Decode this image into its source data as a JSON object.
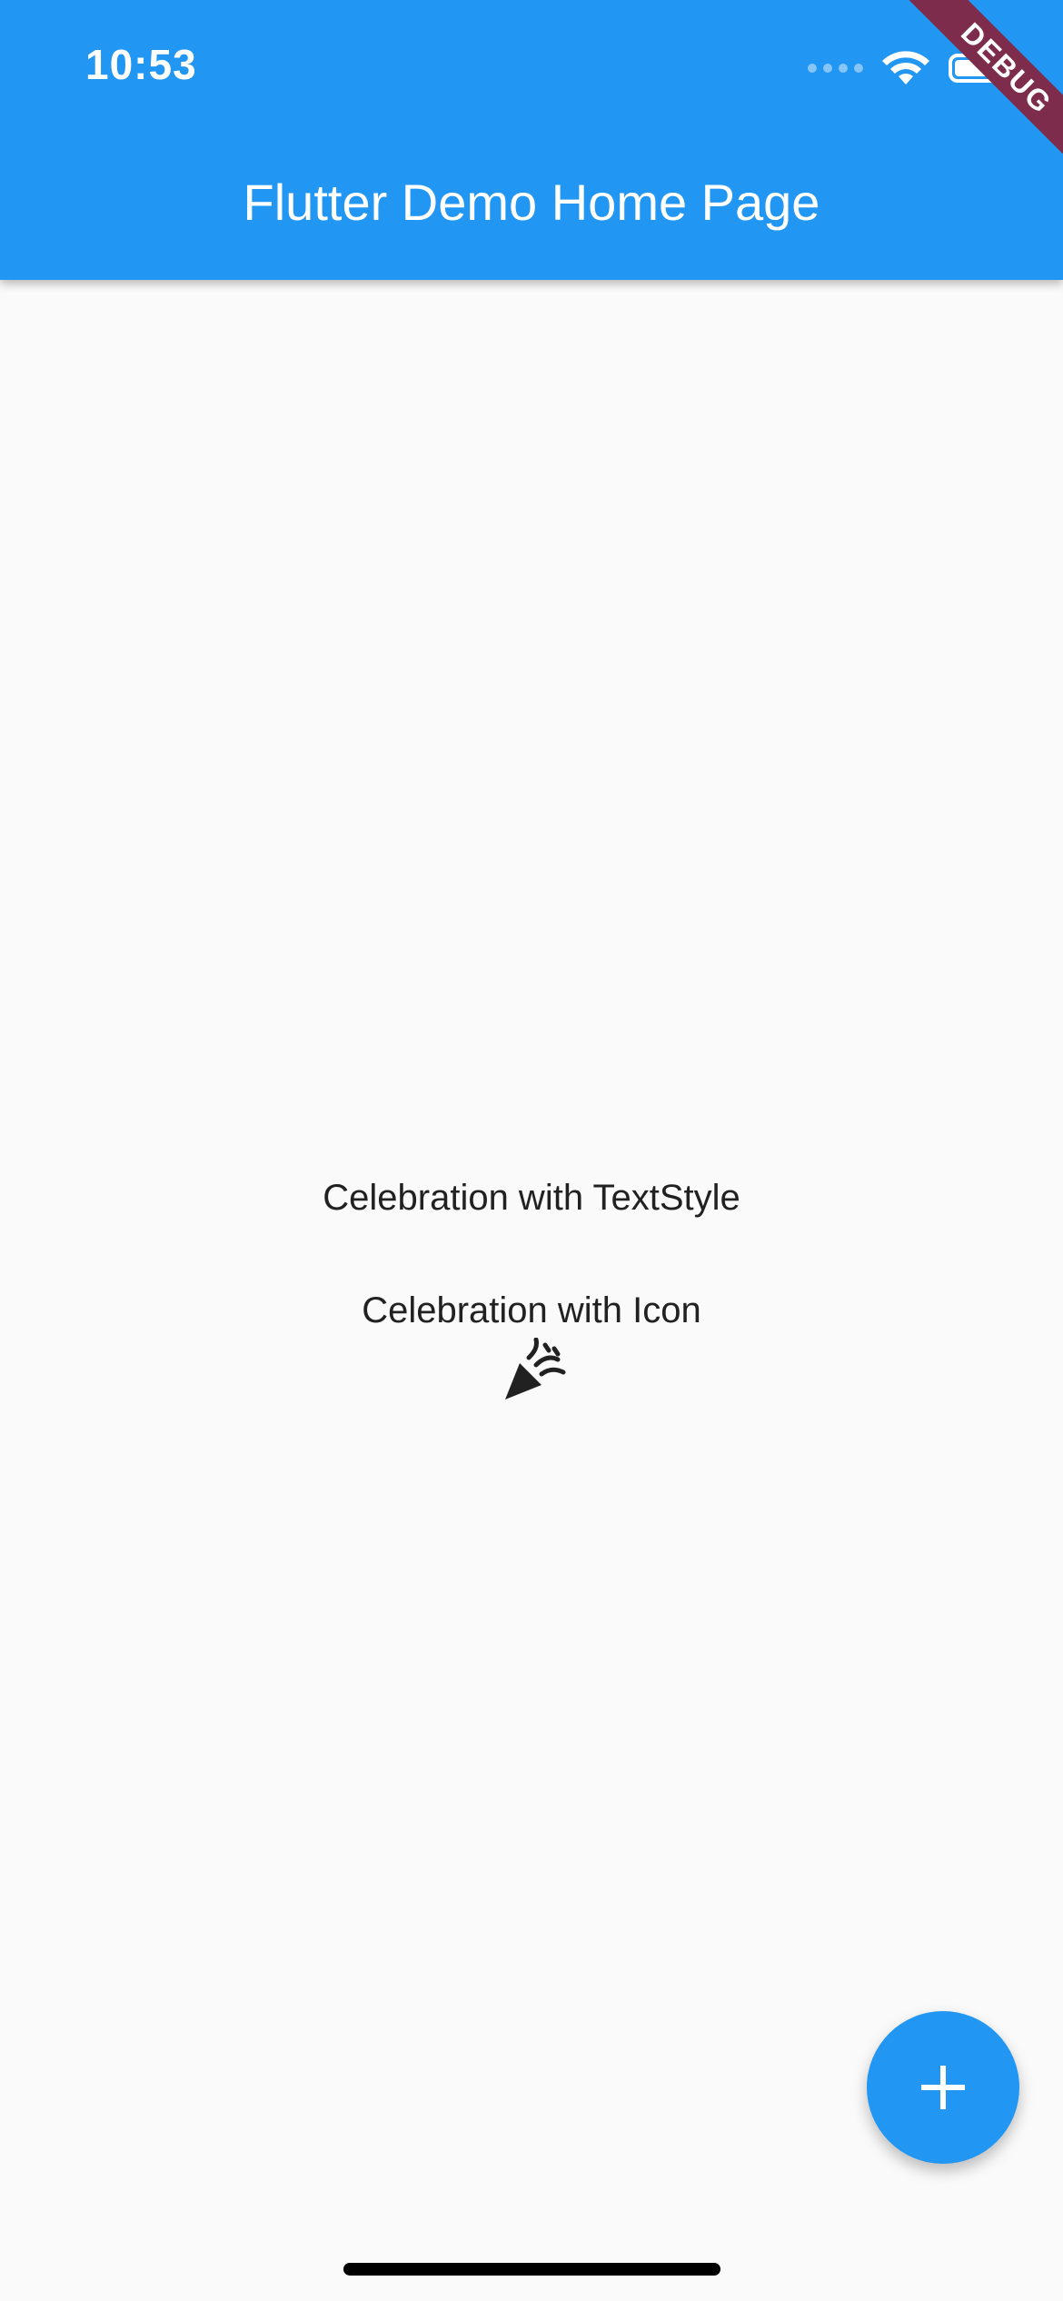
{
  "status_bar": {
    "time": "10:53"
  },
  "app_bar": {
    "title": "Flutter Demo Home Page",
    "color": "#2196f3"
  },
  "debug_banner": {
    "label": "DEBUG",
    "color": "#7d2d4b"
  },
  "content": {
    "text_style_label": "Celebration with TextStyle",
    "icon_label": "Celebration with Icon",
    "icon_name": "celebration-icon"
  },
  "fab": {
    "icon": "plus-icon",
    "color": "#2196f3"
  }
}
